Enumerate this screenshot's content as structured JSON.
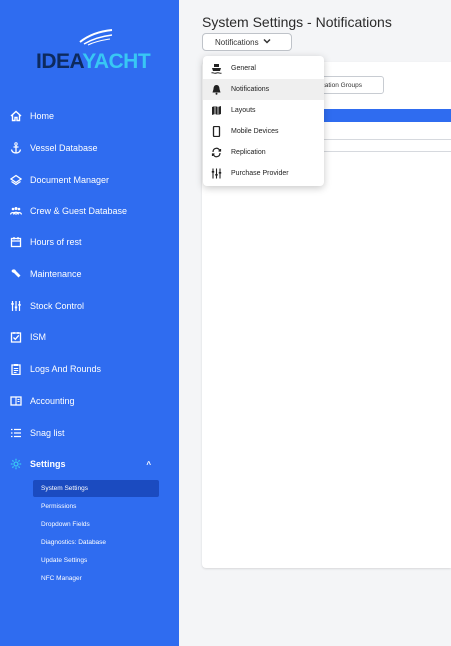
{
  "brand": {
    "part1": "IDEA",
    "part2": "YACHT"
  },
  "sidebar": {
    "items": [
      {
        "label": "Home",
        "icon": "home-icon"
      },
      {
        "label": "Vessel Database",
        "icon": "anchor-icon"
      },
      {
        "label": "Document Manager",
        "icon": "layers-icon"
      },
      {
        "label": "Crew & Guest Database",
        "icon": "people-icon"
      },
      {
        "label": "Hours of rest",
        "icon": "calendar-icon"
      },
      {
        "label": "Maintenance",
        "icon": "wrench-icon"
      },
      {
        "label": "Stock Control",
        "icon": "sliders-icon"
      },
      {
        "label": "ISM",
        "icon": "checkbox-icon"
      },
      {
        "label": "Logs And Rounds",
        "icon": "clipboard-icon"
      },
      {
        "label": "Accounting",
        "icon": "ledger-icon"
      },
      {
        "label": "Snag list",
        "icon": "list-icon"
      }
    ],
    "settings": {
      "label": "Settings",
      "icon": "gear-icon",
      "chevron": "^"
    },
    "sub_items": [
      {
        "label": "System Settings",
        "active": true
      },
      {
        "label": "Permissions"
      },
      {
        "label": "Dropdown Fields"
      },
      {
        "label": "Diagnostics: Database"
      },
      {
        "label": "Update Settings"
      },
      {
        "label": "NFC Manager"
      }
    ]
  },
  "main": {
    "title": "System Settings - Notifications",
    "selector_value": "Notifications",
    "group_button": "tification Groups"
  },
  "menu": {
    "items": [
      {
        "label": "General",
        "icon": "ship-icon"
      },
      {
        "label": "Notifications",
        "icon": "bell-icon",
        "active": true
      },
      {
        "label": "Layouts",
        "icon": "map-icon"
      },
      {
        "label": "Mobile Devices",
        "icon": "phone-icon"
      },
      {
        "label": "Replication",
        "icon": "sync-icon"
      },
      {
        "label": "Purchase Provider",
        "icon": "sliders-icon"
      }
    ]
  },
  "colors": {
    "sidebar": "#2f6cf0",
    "accent": "#2f6cf0",
    "logo_dark": "#0d2a5e",
    "logo_light": "#38c7f4"
  }
}
